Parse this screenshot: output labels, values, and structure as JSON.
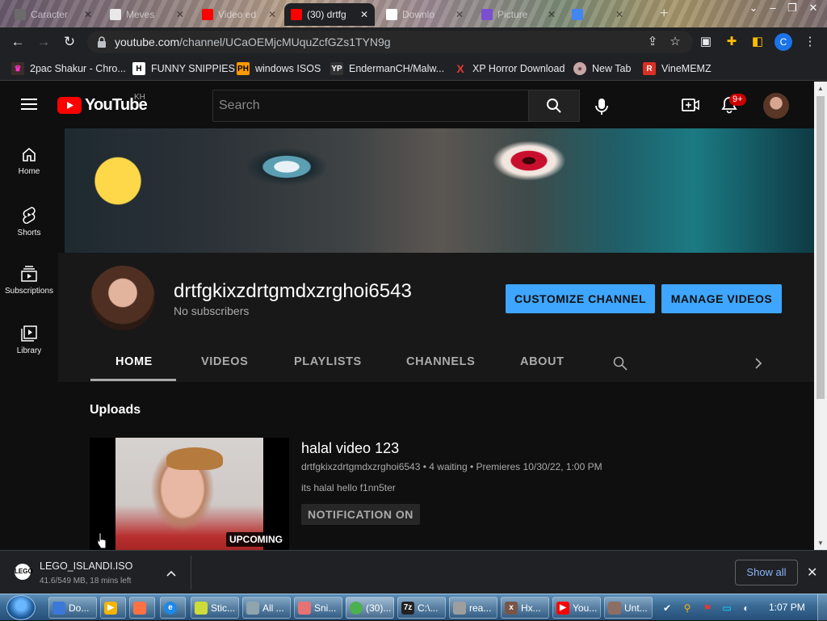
{
  "browser": {
    "tabs": [
      {
        "title": "Caracter",
        "fav_color": "#6b6b6b"
      },
      {
        "title": "Meves",
        "fav_color": "#e8e8e8"
      },
      {
        "title": "Video ed",
        "fav_color": "#ff0000"
      },
      {
        "title": "(30) drtfg",
        "fav_color": "#ff0000"
      },
      {
        "title": "Downlo",
        "fav_color": "#ffffff"
      },
      {
        "title": "Picture",
        "fav_color": "#7a4fd0"
      },
      {
        "title": "",
        "fav_color": "#4285f4"
      }
    ],
    "address": {
      "host": "youtube.com",
      "path": "/channel/UCaOEMjcMUquZcfGZs1TYN9g"
    },
    "profile_initial": "C",
    "bookmarks": [
      {
        "label": "2pac Shakur - Chro...",
        "icon": "H",
        "icon_bg": "#3b2e2a"
      },
      {
        "label": "FUNNY SNIPPIES",
        "icon": "H",
        "icon_bg": "#202124"
      },
      {
        "label": "windows ISOS",
        "icon": "PH",
        "icon_bg": "#ff9900"
      },
      {
        "label": "EndermanCH/Malw...",
        "icon": "YP",
        "icon_bg": "#333"
      },
      {
        "label": "XP Horror Download",
        "icon": "X",
        "icon_bg": "#202124"
      },
      {
        "label": "New Tab",
        "icon": "●",
        "icon_bg": "#c7a6a6"
      },
      {
        "label": "VineMEMZ",
        "icon": "R",
        "icon_bg": "#d93025"
      }
    ]
  },
  "youtube": {
    "logo_text": "YouTube",
    "region": "KH",
    "search_placeholder": "Search",
    "notification_count": "9+",
    "sidebar": [
      {
        "label": "Home",
        "icon": "home-icon"
      },
      {
        "label": "Shorts",
        "icon": "shorts-icon"
      },
      {
        "label": "Subscriptions",
        "icon": "subscriptions-icon"
      },
      {
        "label": "Library",
        "icon": "library-icon"
      }
    ],
    "channel": {
      "name": "drtfgkixzdrtgmdxzrghoi6543",
      "subscribers": "No subscribers",
      "customize_label": "CUSTOMIZE CHANNEL",
      "manage_label": "MANAGE VIDEOS",
      "tabs": [
        "HOME",
        "VIDEOS",
        "PLAYLISTS",
        "CHANNELS",
        "ABOUT"
      ],
      "active_tab": "HOME"
    },
    "uploads": {
      "heading": "Uploads",
      "video": {
        "title": "halal video 123",
        "meta": "drtfgkixzdrtgmdxzrghoi6543 • 4 waiting • Premieres 10/30/22, 1:00 PM",
        "description": "its halal hello f1nn5ter",
        "notify_label": "NOTIFICATION ON",
        "badge": "UPCOMING"
      }
    }
  },
  "downloads": {
    "filename": "LEGO_ISLANDI.ISO",
    "status": "41.6/549 MB, 18 mins left",
    "show_all": "Show all"
  },
  "taskbar": {
    "tasks": [
      {
        "label": "Do...",
        "icon_bg": "#3c78d8"
      },
      {
        "label": "",
        "icon_bg": "#f4b400"
      },
      {
        "label": "",
        "icon_bg": "#ff7043"
      },
      {
        "label": "",
        "icon_bg": "#1e88e5"
      },
      {
        "label": "Stic...",
        "icon_bg": "#cddc39"
      },
      {
        "label": "All ...",
        "icon_bg": "#90a4ae"
      },
      {
        "label": "Sni...",
        "icon_bg": "#e57373"
      },
      {
        "label": "(30)...",
        "icon_bg": "#4caf50"
      },
      {
        "label": "C:\\...",
        "icon_bg": "#222"
      },
      {
        "label": "rea...",
        "icon_bg": "#9e9e9e"
      },
      {
        "label": "Hx...",
        "icon_bg": "#795548"
      },
      {
        "label": "You...",
        "icon_bg": "#ff0000"
      },
      {
        "label": "Unt...",
        "icon_bg": "#8d6e63"
      }
    ],
    "clock": "1:07 PM"
  },
  "colors": {
    "accent": "#3ea6ff",
    "yt_red": "#ff0000",
    "bg": "#0f0f0f",
    "channel_bg": "#181818"
  }
}
